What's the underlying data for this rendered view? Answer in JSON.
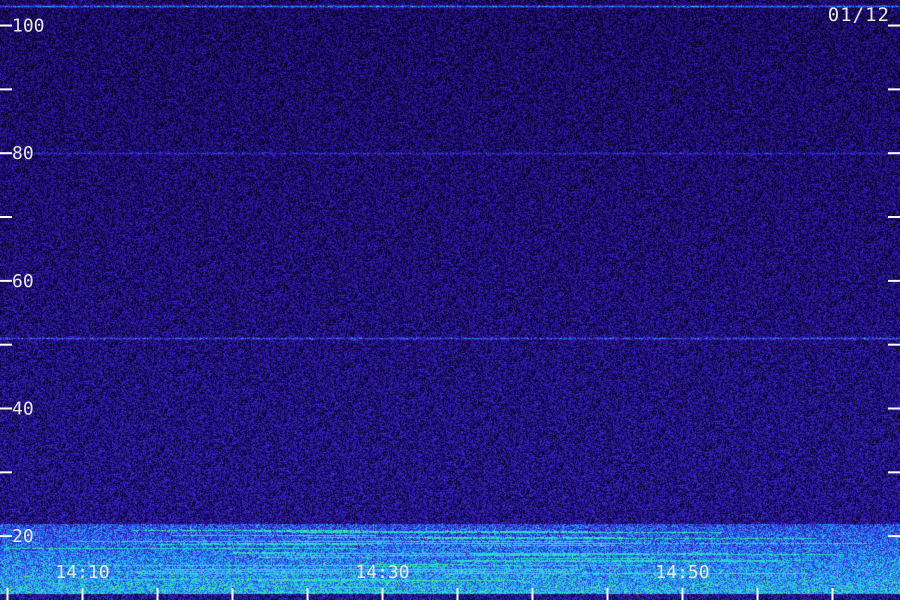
{
  "header": {
    "date": "01/12"
  },
  "chart_data": {
    "type": "heatmap",
    "title": "",
    "xlabel": "",
    "ylabel": "",
    "x_ticks": [
      {
        "label": "14:10",
        "minute": 10
      },
      {
        "label": "14:30",
        "minute": 30
      },
      {
        "label": "14:50",
        "minute": 50
      }
    ],
    "x_minor_tick_interval_minutes": 5,
    "xlim_minutes": [
      4.5,
      64.5
    ],
    "y_ticks": [
      20,
      40,
      60,
      80,
      100
    ],
    "y_minor_ticks": [
      30,
      50,
      70,
      90
    ],
    "ylim": [
      10,
      104
    ],
    "grid": false,
    "colormap": [
      "#000000",
      "#1a0a6e",
      "#3a1fc4",
      "#2a6cff",
      "#22ccee",
      "#55ff66"
    ],
    "noise_floor_color": "#2e1aa8",
    "horizontal_lines": [
      {
        "y": 103,
        "intensity": 0.85
      },
      {
        "y": 80,
        "intensity": 0.35
      },
      {
        "y": 51,
        "intensity": 0.55
      }
    ],
    "low_band": {
      "from": 11,
      "to": 22,
      "intensity": "high"
    }
  }
}
